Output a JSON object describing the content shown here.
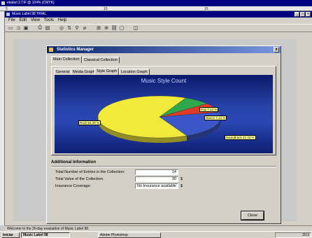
{
  "ps_window": {
    "title": "etiabel 2.TIF @ 104% (CMYK)"
  },
  "ruler": {
    "ticks": [
      "5",
      "10",
      "15"
    ]
  },
  "app": {
    "title": "Music Label 98 TRIAL",
    "menu": [
      "File",
      "Edit",
      "View",
      "Tools",
      "Help"
    ],
    "toolbar_icons": [
      "new-icon",
      "open-icon",
      "save-icon",
      "print-icon",
      "preview-icon",
      "zoom-icon",
      "search-icon",
      "tag-icon",
      "stats-icon",
      "sort-icon",
      "grid-icon",
      "window-icon"
    ],
    "status": "Welcome to the 30-day evaluation of Music Label 98."
  },
  "dialog": {
    "title": "Statistics Manager",
    "close_glyph": "x",
    "outer_tabs": [
      "Main Collection",
      "Classical Collection"
    ],
    "inner_tabs": [
      "General",
      "Media Graph",
      "Style Graph",
      "Location Graph"
    ],
    "close_button": "Close",
    "additional": {
      "heading": "Additional Information",
      "rows": [
        {
          "label": "Total Number of Entries in the Collection:",
          "value": "14",
          "unit": ""
        },
        {
          "label": "Total Value of the Collection:",
          "value": "30",
          "unit": "$"
        },
        {
          "label": "Insurance Coverage:",
          "value": "No Insurance available",
          "unit": "$"
        }
      ]
    }
  },
  "chart_data": {
    "type": "pie",
    "title": "Music Style Count",
    "slices": [
      {
        "label": "Rock 64.29 %",
        "value": 64.29,
        "color": "#f2ea3a"
      },
      {
        "label": "Pop 7.14 %",
        "value": 7.14,
        "color": "#2ea84a"
      },
      {
        "label": "Dance 7.14 %",
        "value": 7.14,
        "color": "#e23a2a"
      },
      {
        "label": "Soundtrack 21.43 %",
        "value": 21.43,
        "color": "#3a56c8"
      }
    ]
  },
  "taskbar": {
    "start_label": "Iniciar",
    "tasks": [
      "Music Label 98",
      "Adobe Photoshop"
    ],
    "clock": "20:3"
  }
}
